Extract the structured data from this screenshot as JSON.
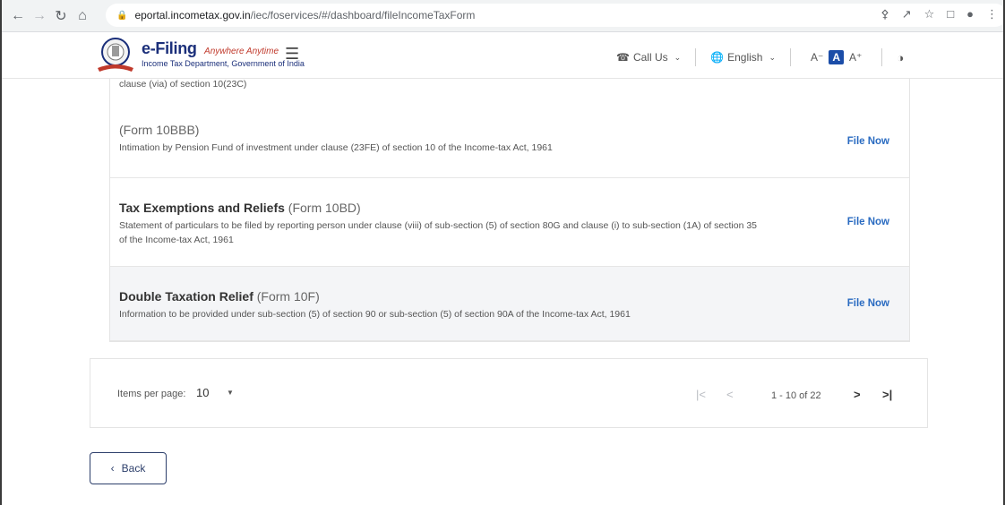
{
  "browser": {
    "url_host": "eportal.incometax.gov.in",
    "url_path": "/iec/foservices/#/dashboard/fileIncomeTaxForm"
  },
  "header": {
    "brand_name": "e-Filing",
    "brand_tagline": "Anywhere Anytime",
    "brand_dept": "Income Tax Department, Government of India",
    "call_us": "Call Us",
    "language": "English",
    "font_decrease": "A⁻",
    "font_normal": "A",
    "font_increase": "A⁺"
  },
  "list": {
    "partial_desc": "clause (via) of section 10(23C)",
    "rows": [
      {
        "title_main": "",
        "title_form": "(Form 10BBB)",
        "desc": "Intimation by Pension Fund of investment under clause (23FE) of section 10 of the Income-tax Act, 1961",
        "action": "File Now"
      },
      {
        "title_main": "Tax Exemptions and Reliefs",
        "title_form": "(Form 10BD)",
        "desc": "Statement of particulars to be filed by reporting person under clause (viii) of sub-section (5) of section 80G and clause (i) to sub-section (1A) of section 35 of the Income-tax Act, 1961",
        "action": "File Now"
      },
      {
        "title_main": "Double Taxation Relief",
        "title_form": "(Form 10F)",
        "desc": "Information to be provided under sub-section (5) of section 90 or sub-section (5) of section 90A of the Income-tax Act, 1961",
        "action": "File Now"
      }
    ]
  },
  "pagination": {
    "items_per_page_label": "Items per page:",
    "items_per_page": "10",
    "range": "1 - 10 of 22"
  },
  "back_label": "Back",
  "colors": {
    "link": "#2a6bc1",
    "brand": "#1b2f7a",
    "active_font": "#1b4da8"
  }
}
